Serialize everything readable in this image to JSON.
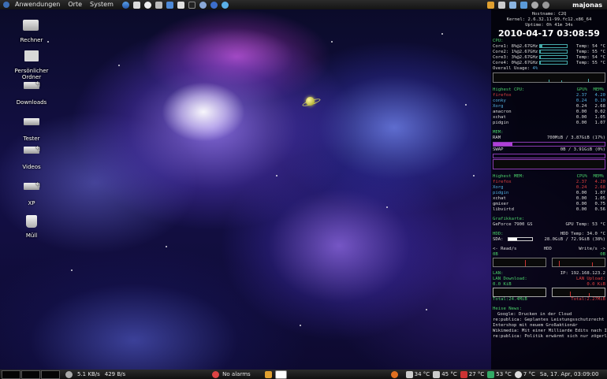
{
  "top_panel": {
    "menus": [
      "Anwendungen",
      "Orte",
      "System"
    ],
    "launchers": [
      "firefox-icon",
      "printer-icon",
      "terminal-icon",
      "text-editor-icon",
      "notes-icon",
      "document-icon",
      "screen-icon",
      "gear-icon",
      "thunderbird-icon",
      "network-icon"
    ],
    "user": "majonas"
  },
  "desktop_icons": [
    {
      "label": "Rechner",
      "icon": "computer-icon"
    },
    {
      "label": "Persönlicher Ordner",
      "icon": "home-folder-icon"
    },
    {
      "label": "Downloads",
      "icon": "folder-link-icon"
    },
    {
      "label": "Tester",
      "icon": "folder-icon"
    },
    {
      "label": "Videos",
      "icon": "folder-link-icon"
    },
    {
      "label": "XP",
      "icon": "folder-link-icon"
    },
    {
      "label": "Müll",
      "icon": "trash-icon"
    }
  ],
  "conky": {
    "hostname": "Hostname: C2Q",
    "kernel": "Kernel: 2.6.32.11-99.fc12.x86_64",
    "uptime": "Uptime: 0h 41m 34s",
    "datetime": "2010-04-17 03:08:59",
    "cpu_label": "CPU:",
    "cores": [
      {
        "name": "Core1:",
        "usage": "8%@2.67GHz",
        "fill": 0.08,
        "temp": "Temp: 54 °C"
      },
      {
        "name": "Core2:",
        "usage": "1%@2.67GHz",
        "fill": 0.01,
        "temp": "Temp: 55 °C"
      },
      {
        "name": "Core3:",
        "usage": "3%@2.67GHz",
        "fill": 0.03,
        "temp": "Temp: 54 °C"
      },
      {
        "name": "Core4:",
        "usage": "0%@2.67GHz",
        "fill": 0.0,
        "temp": "Temp: 55 °C"
      }
    ],
    "overall_label": "Overall Usage:",
    "overall_value": "4%",
    "highest_cpu_label": "Highest CPU:",
    "cpu_col": "GPU%",
    "mem_col": "MEM%",
    "highest_cpu": [
      {
        "name": "firefox",
        "cpu": "2.37",
        "mem": "4.20"
      },
      {
        "name": "conky",
        "cpu": "0.24",
        "mem": "0.10"
      },
      {
        "name": "Xorg",
        "cpu": "0.24",
        "mem": "2.68"
      },
      {
        "name": "anacron",
        "cpu": "0.00",
        "mem": "0.02"
      },
      {
        "name": "xchat",
        "cpu": "0.00",
        "mem": "1.05"
      },
      {
        "name": "pidgin",
        "cpu": "0.00",
        "mem": "1.07"
      }
    ],
    "mem_label": "MEM:",
    "ram_label": "RAM",
    "ram_value": "700MiB  / 3.87GiB (17%)",
    "ram_fill": 0.17,
    "swap_label": "SWAP",
    "swap_value": "0B  / 3.91GiB (0%)",
    "swap_fill": 0.0,
    "highest_mem_label": "Highest MEM:",
    "mem_cpu_col": "CPU%",
    "mem_mem_col": "MEM%",
    "highest_mem": [
      {
        "name": "firefox",
        "cpu": "2.37",
        "mem": "4.20"
      },
      {
        "name": "Xorg",
        "cpu": "0.24",
        "mem": "2.68"
      },
      {
        "name": "pidgin",
        "cpu": "0.00",
        "mem": "1.07"
      },
      {
        "name": "xchat",
        "cpu": "0.00",
        "mem": "1.05"
      },
      {
        "name": "gmixer",
        "cpu": "0.00",
        "mem": "0.75"
      },
      {
        "name": "libvirtd",
        "cpu": "0.00",
        "mem": "0.56"
      }
    ],
    "gpu_label": "Grafikkarte:",
    "gpu_name": "GeForce 7900 GS",
    "gpu_temp": "GPU Temp: 53 °C",
    "hdd_label": "HDD:",
    "hdd_temp": "HDD Temp: 34.0 °C",
    "sda_label": "SDA:",
    "sda_value": "28.0GiB  / 72.9GiB (38%)",
    "sda_fill": 0.38,
    "reads_label": "<- Read/s",
    "hdd_mid": "HDD",
    "writes_label": "Write/s ->",
    "reads_value": "0B",
    "writes_value": "0B",
    "lan_label": "LAN:",
    "ip": "IP: 192.168.123.2",
    "lan_down_label": "LAN Download:",
    "lan_up_label": "LAN Upload:",
    "lan_down_value": "0.0   KiB",
    "lan_up_value": "0.0   KiB",
    "total_down": "Total:24.4MiB",
    "total_up": "Total:2.27MiB",
    "news_label": "Heise News:",
    "news": [
      "Google: Drucken in der Cloud",
      "re:publica: Geplantes Leistungsschutzrecht macht Blo",
      "Intershop mit neuem Großaktionär",
      "Wikimedia: Mit einer Milliarde Edits nach Indien",
      "re:publica: Politik erwärmt sich nur zögerlich für Ope"
    ]
  },
  "bottom_panel": {
    "net_down": "5.1 KB/s",
    "net_up": "429 B/s",
    "alarm": "No alarms",
    "temps": [
      "34 °C",
      "45 °C",
      "27 °C",
      "53 °C",
      "7 °C"
    ],
    "clock": "Sa, 17. Apr, 03:09:00"
  }
}
